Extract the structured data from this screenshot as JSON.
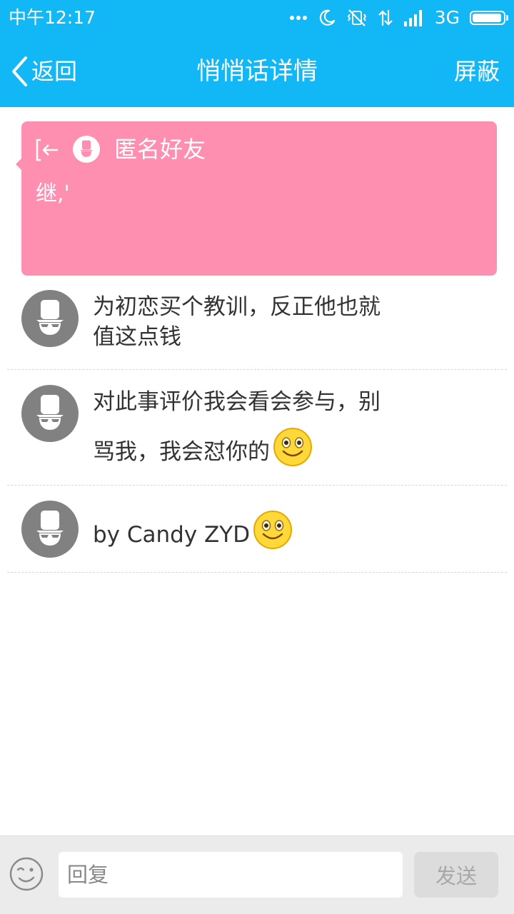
{
  "status_bar": {
    "time": "中午12:17",
    "network": "3G",
    "battery_level": 0.95,
    "icons": [
      "more-dots-icon",
      "moon-icon",
      "vibrate-off-icon",
      "data-arrows-icon",
      "signal-bars-icon",
      "battery-icon"
    ]
  },
  "nav": {
    "back_label": "返回",
    "title": "悄悄话详情",
    "action_label": "屏蔽"
  },
  "whisper": {
    "sender": "匿名好友",
    "message": "继,'",
    "color": "#ff8fb0",
    "icons": [
      "exit-arrow-icon",
      "anonymous-avatar-icon"
    ]
  },
  "comments": [
    {
      "lines": [
        "为初恋买个教训，反正他也就",
        "值这点钱"
      ],
      "emoji": "",
      "avatar_icon": "anonymous-avatar-icon"
    },
    {
      "lines": [
        "对此事评价我会看会参与，别",
        "骂我，我会怼你的"
      ],
      "emoji": "smile-emoji-icon",
      "avatar_icon": "anonymous-avatar-icon"
    },
    {
      "lines": [
        "by Candy ZYD"
      ],
      "emoji": "smile-emoji-icon",
      "avatar_icon": "anonymous-avatar-icon"
    }
  ],
  "reply_bar": {
    "placeholder": "回复",
    "value": "",
    "send_label": "发送",
    "emoji_icon": "wink-face-icon"
  },
  "colors": {
    "accent": "#12b7f5",
    "card": "#ff8fb0",
    "avatar": "#818181",
    "divider": "#f0c8dc",
    "reply_bar_bg": "#ebebeb"
  }
}
